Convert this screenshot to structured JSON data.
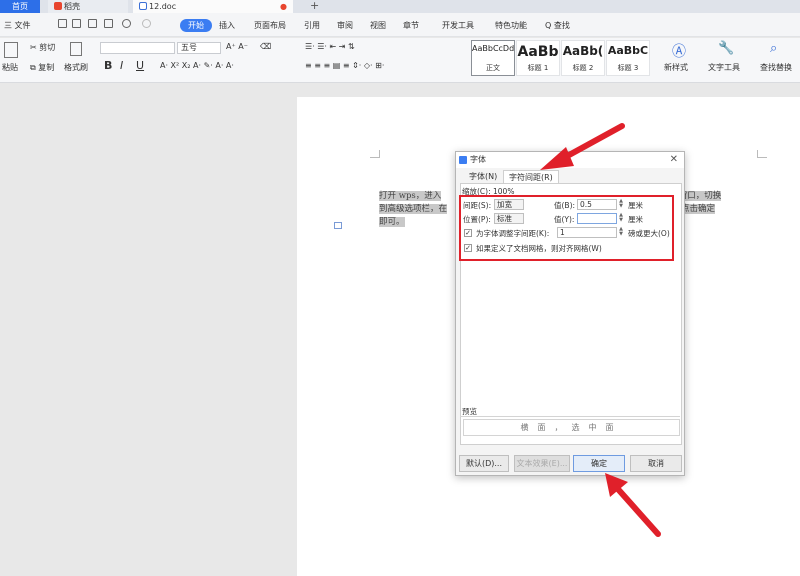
{
  "tabs": {
    "home": "首页",
    "daoke": "稻壳",
    "doc": "12.doc"
  },
  "menu": {
    "file": "三 文件",
    "start": "开始",
    "insert": "插入",
    "layout": "页面布局",
    "reference": "引用",
    "review": "审阅",
    "view": "视图",
    "chapter": "章节",
    "devtools": "开发工具",
    "special": "特色功能",
    "search": "Q 查找"
  },
  "ribbon": {
    "paste": "粘贴",
    "cut": "剪切",
    "copy": "复制",
    "format_painter": "格式刷",
    "font_size": "五号",
    "bold": "B",
    "italic": "I",
    "underline": "U",
    "styles": [
      {
        "sample": "AaBbCcDd",
        "name": "正文"
      },
      {
        "sample": "AaBb",
        "name": "标题 1"
      },
      {
        "sample": "AaBb(",
        "name": "标题 2"
      },
      {
        "sample": "AaBbC",
        "name": "标题 3"
      }
    ],
    "new_style": "新样式",
    "text_tools": "文字工具",
    "find_replace": "查找替换"
  },
  "document": {
    "line1_a": "打开 wps，进入",
    "line1_b": "，弹出窗口，切换",
    "line2_a": "到高级选项栏，在",
    "line2_b": "置磅值，点击确定",
    "line3": "即可。"
  },
  "dialog": {
    "title": "字体",
    "tab_font": "字体(N)",
    "tab_spacing": "字符间距(R)",
    "scale_label": "缩放(C): 100%",
    "spacing_label": "间距(S):",
    "spacing_value": "加宽",
    "spacing_by_label": "值(B):",
    "spacing_by_value": "0.5",
    "unit1": "厘米",
    "position_label": "位置(P):",
    "position_value": "标准",
    "position_by_label": "值(Y):",
    "unit2": "厘米",
    "kerning_label": "为字体调整字间距(K):",
    "kerning_value": "1",
    "kerning_suffix": "磅或更大(O)",
    "grid_label": "如果定义了文档网格，则对齐网格(W)",
    "preview_label": "预览",
    "preview_text": "横面，选中面",
    "btn_default": "默认(D)...",
    "btn_text_effect": "文本效果(E)...",
    "btn_ok": "确定",
    "btn_cancel": "取消"
  },
  "colors": {
    "accent": "#3b7df2",
    "highlight_red": "#e0202a"
  }
}
